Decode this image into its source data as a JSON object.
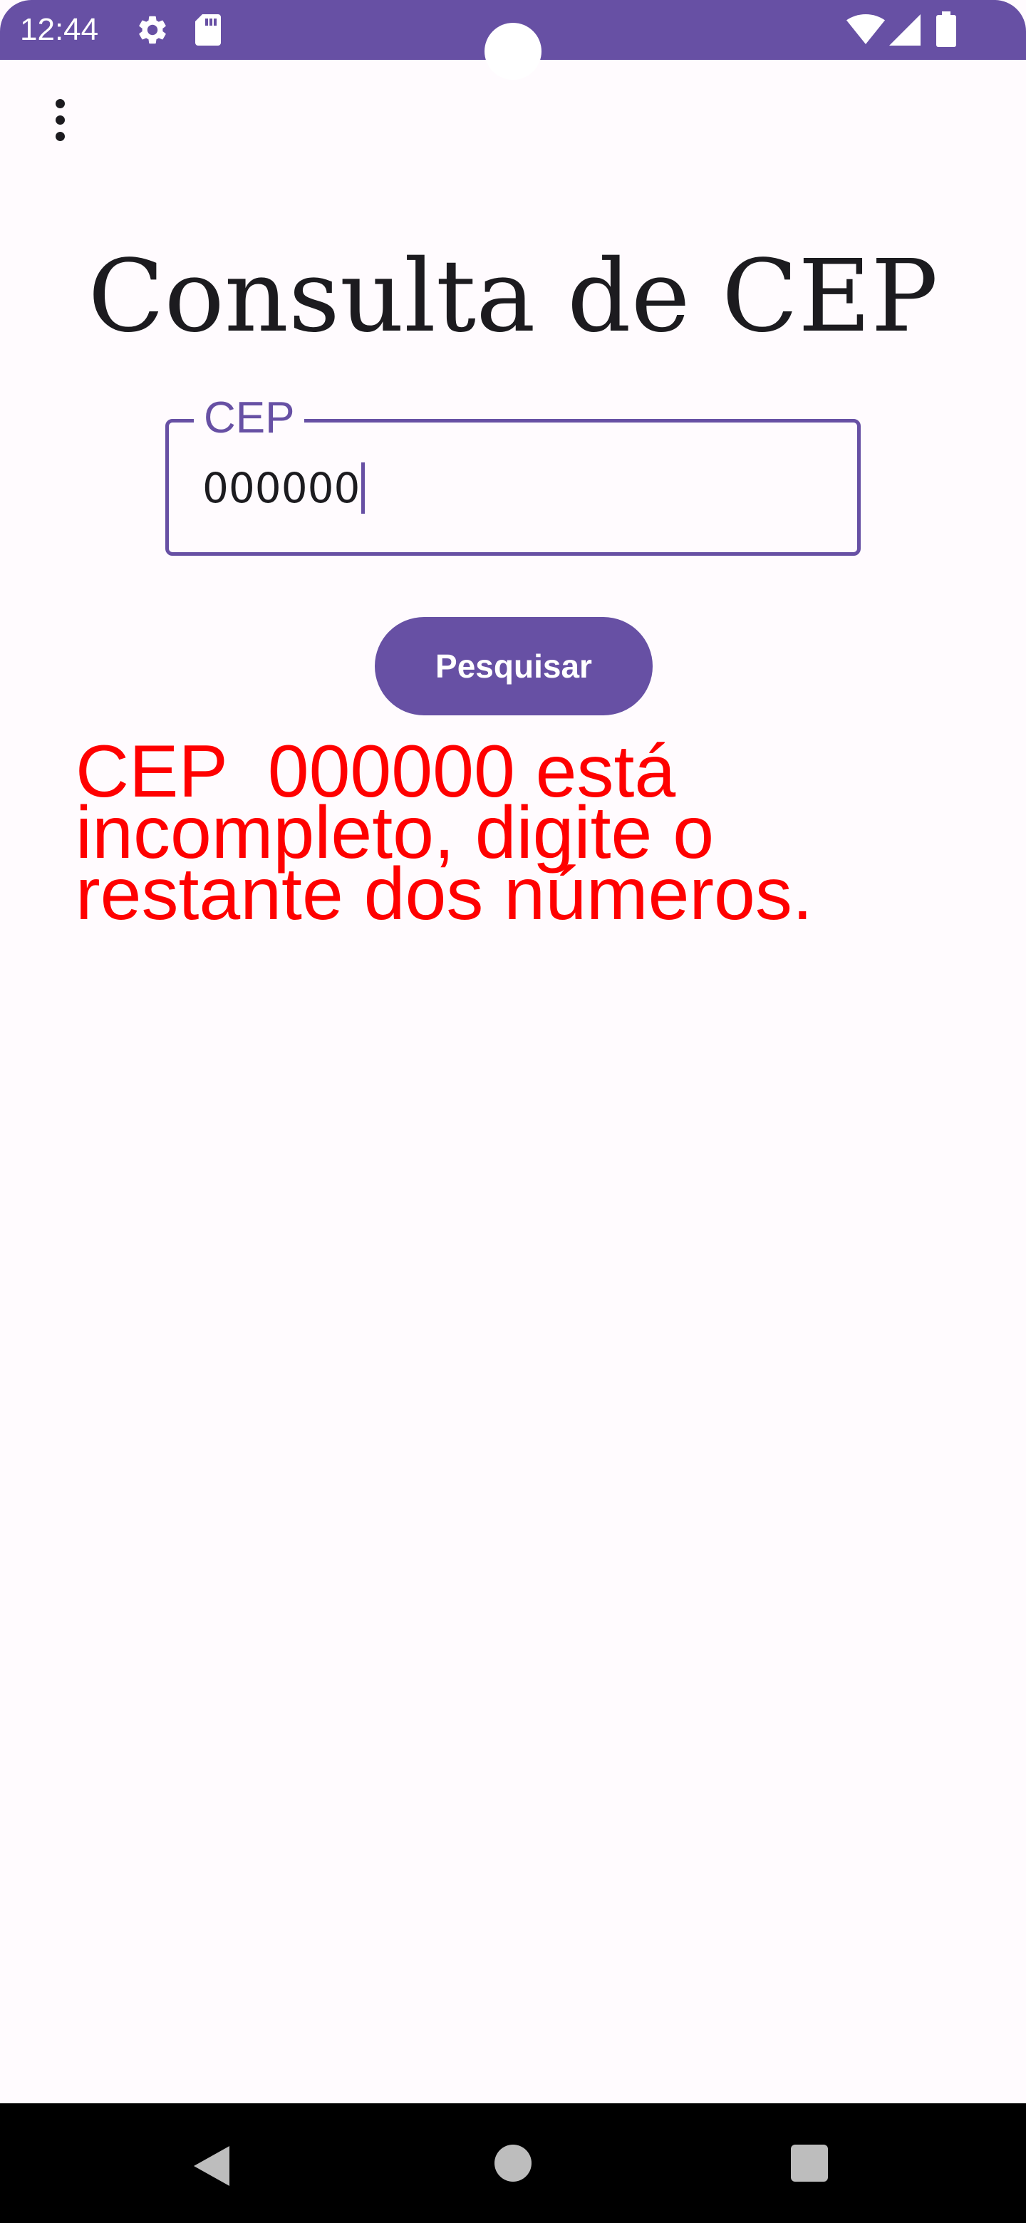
{
  "status_bar": {
    "time": "12:44",
    "icons": [
      "settings-gear-icon",
      "sd-card-icon",
      "wifi-icon",
      "cellular-signal-icon",
      "battery-icon"
    ],
    "background_color": "#6750a4"
  },
  "app": {
    "menu_icon": "more-vert-icon",
    "title": "Consulta de CEP",
    "cep_field": {
      "label": "CEP",
      "value": "000000"
    },
    "search_button_label": "Pesquisar",
    "error_message": "CEP  000000 está\nincompleto, digite o\nrestante dos números.",
    "accent_color": "#6750a4",
    "error_color": "#ff0000"
  },
  "nav_bar": {
    "icons": [
      "back-icon",
      "home-icon",
      "recents-icon"
    ]
  }
}
